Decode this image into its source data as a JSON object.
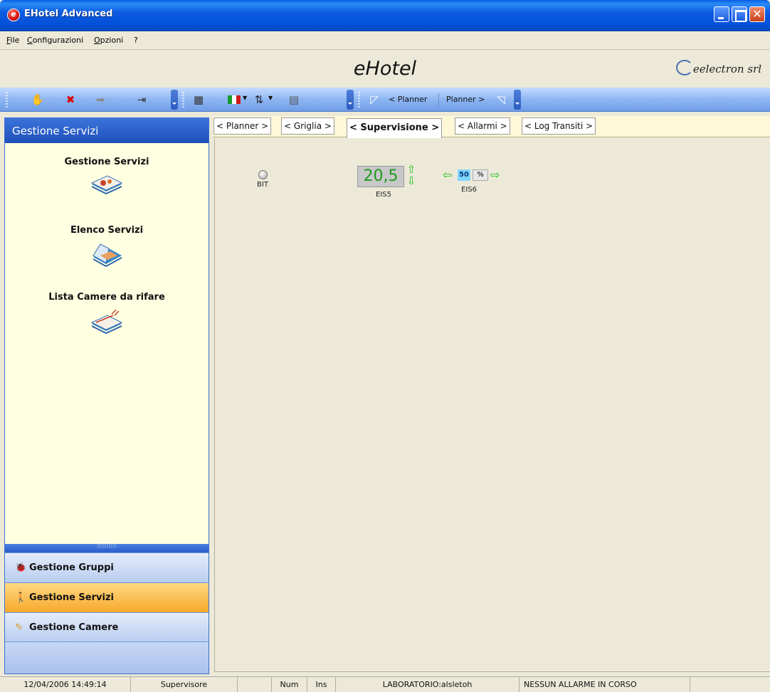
{
  "window": {
    "title": "EHotel Advanced",
    "app_icon_glyph": "e",
    "close_glyph": "✕"
  },
  "menu": {
    "file": "File",
    "file_hotkey": "F",
    "file_rest": "ile",
    "config": "Configurazioni",
    "config_hotkey": "C",
    "config_rest": "onfigurazioni",
    "options": "Opzioni",
    "options_hotkey": "O",
    "options_rest": "pzioni",
    "help": "?"
  },
  "header": {
    "brand": "eHotel",
    "company": "eelectron srl"
  },
  "toolbar": {
    "planner_prev": "< Planner",
    "planner_next": "Planner >",
    "icons": [
      "hand-icon",
      "delete-icon",
      "forward-icon",
      "exit-icon",
      "calendar-icon",
      "language-flag-icon",
      "sort-icon",
      "grid-icon"
    ]
  },
  "sidebar": {
    "header": "Gestione Servizi",
    "items": [
      {
        "label": "Gestione Servizi"
      },
      {
        "label": "Elenco Servizi"
      },
      {
        "label": "Lista Camere da rifare"
      }
    ],
    "splitter": "::::::::::",
    "nav": [
      {
        "label": "Gestione Gruppi",
        "icon": "🐞"
      },
      {
        "label": "Gestione Servizi",
        "icon": "🚶"
      },
      {
        "label": "Gestione Camere",
        "icon": "✎"
      }
    ]
  },
  "tabs": [
    "< Planner >",
    "< Griglia >",
    "< Supervisione >",
    "< Allarmi >",
    "< Log Transiti >"
  ],
  "supervision": {
    "bit": {
      "label": "BIT",
      "state": "off"
    },
    "eis5": {
      "value": "20,5",
      "label": "EIS5",
      "up": "⇧",
      "down": "⇩"
    },
    "eis6": {
      "value": "50",
      "unit": "%",
      "label": "EIS6",
      "left": "⇦",
      "right": "⇨"
    }
  },
  "status": {
    "datetime": "12/04/2006 14:49:14",
    "role": "Supervisore",
    "num": "Num",
    "ins": "Ins",
    "station": "LABORATORIO:alsletoh",
    "alarm": "NESSUN ALLARME IN CORSO"
  },
  "colors": {
    "titlebar": "#0351d8",
    "sidebar_bg": "#ffffe1",
    "active_nav": "#f6a92a",
    "value_green": "#1e9a1e"
  }
}
